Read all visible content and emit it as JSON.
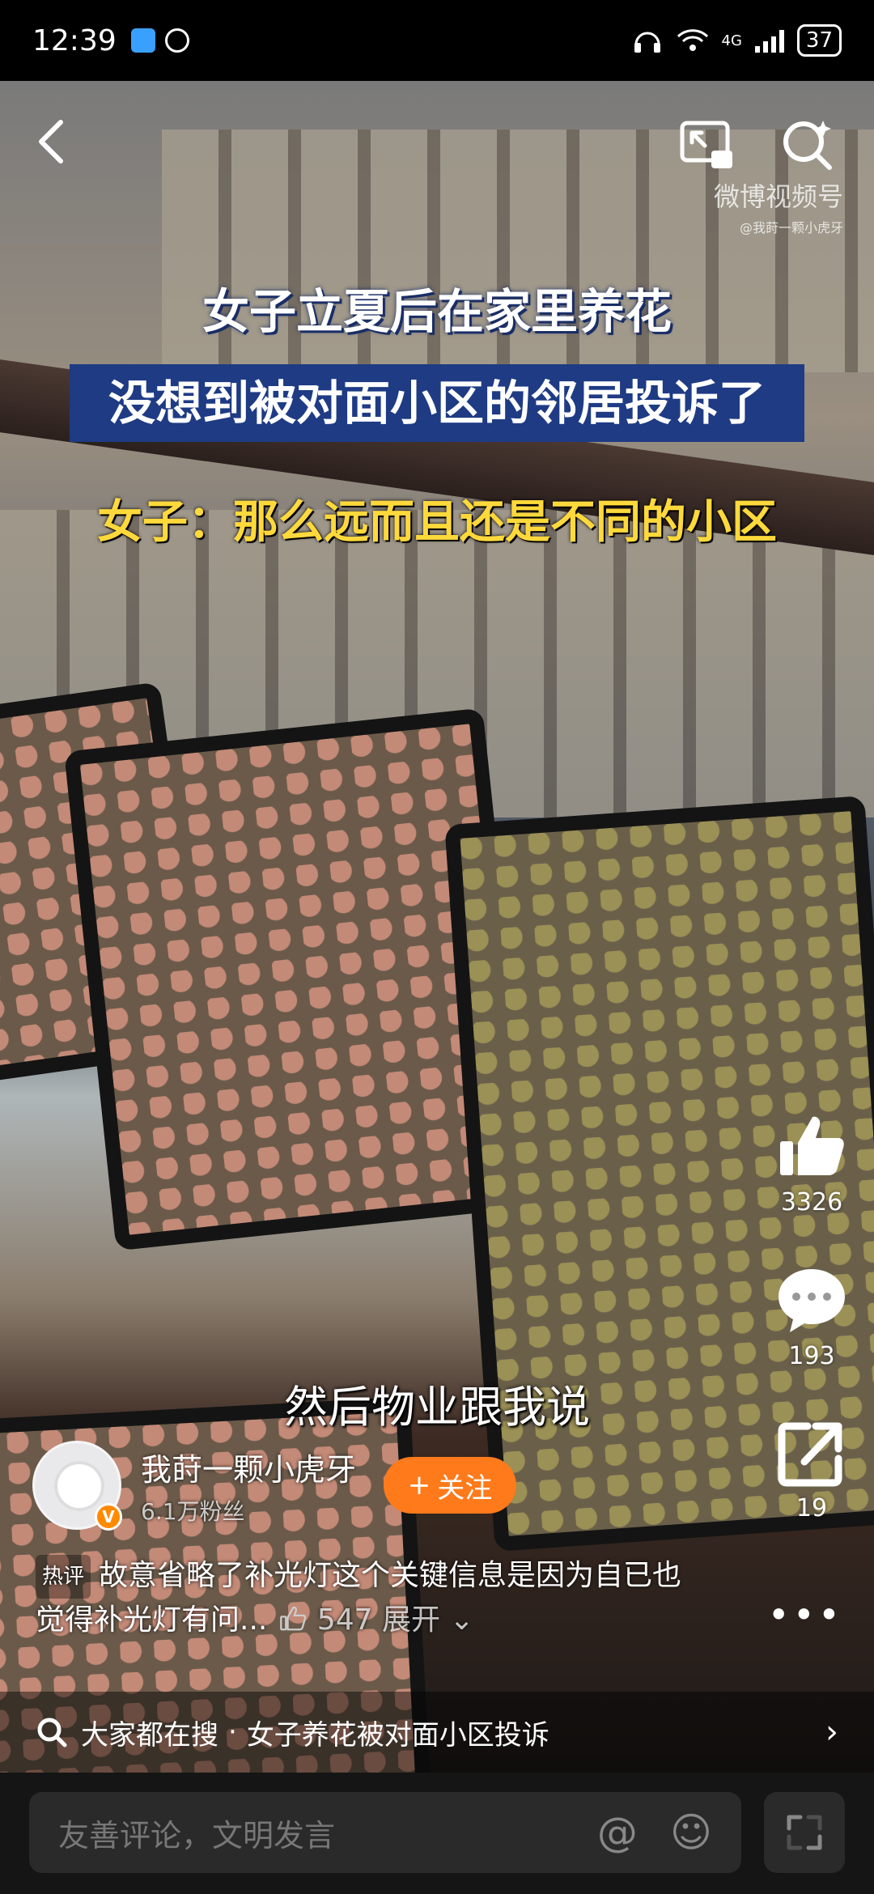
{
  "status_bar": {
    "time": "12:39",
    "network": "4G",
    "battery": "37"
  },
  "watermark": {
    "line1": "微博视频号",
    "line2": "@我莳一颗小虎牙"
  },
  "captions": {
    "line1": "女子立夏后在家里养花",
    "line2": "没想到被对面小区的邻居投诉了",
    "line3": "女子：那么远而且还是不同的小区"
  },
  "subtitle": "然后物业跟我说",
  "actions": {
    "like_count": "3326",
    "comment_count": "193",
    "share_count": "19"
  },
  "author": {
    "name": "我莳一颗小虎牙",
    "fans": "6.1万粉丝",
    "verified_badge": "V",
    "follow_label": "关注",
    "follow_plus": "+"
  },
  "hot_comment": {
    "tag": "热评",
    "text": "故意省略了补光灯这个关键信息是因为自已也觉得补光灯有问...",
    "likes": "547",
    "expand": "展开"
  },
  "search": {
    "prefix": "大家都在搜",
    "separator": "·",
    "query": "女子养花被对面小区投诉"
  },
  "comment_input": {
    "placeholder": "友善评论，文明发言",
    "at_symbol": "@",
    "emoji_symbol": "☺"
  },
  "icons": {
    "back": "back-icon",
    "pip": "pip-icon",
    "search": "search-icon",
    "like": "like-icon",
    "comment": "comment-icon",
    "share": "share-icon",
    "more": "more-icon",
    "expand": "expand-icon"
  },
  "colors": {
    "follow": "#ff7a1a",
    "caption_bg": "#1e3b84",
    "caption_yellow": "#ffd93b"
  }
}
